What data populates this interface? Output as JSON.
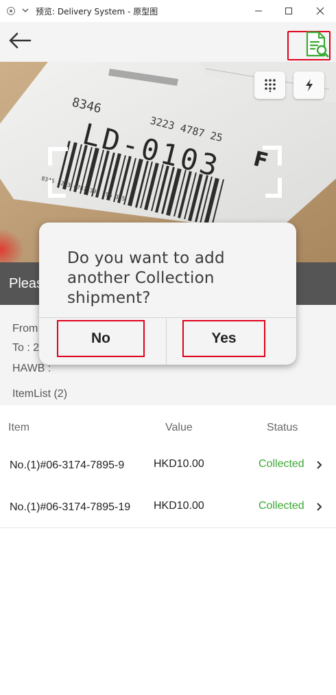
{
  "window": {
    "title": "预览: Delivery System - 原型图"
  },
  "camera": {
    "label_text": "LD-0103",
    "label_top_digits": "8346",
    "label_mid_digits": "3223 4787 25",
    "label_letter": "F",
    "barcode_digits": "8346 3223 4787 398 296 395"
  },
  "banner": {
    "text": "Pleas"
  },
  "shipment": {
    "from_label": "From",
    "to_label": "To : 2",
    "hawb_label": "HAWB :",
    "itemlist_label": "ItemList (2)"
  },
  "table": {
    "headers": {
      "item": "Item",
      "value": "Value",
      "status": "Status"
    },
    "rows": [
      {
        "item": "No.(1)#06-3174-7895-9",
        "value": "HKD10.00",
        "status": "Collected"
      },
      {
        "item": "No.(1)#06-3174-7895-19",
        "value": "HKD10.00",
        "status": "Collected"
      }
    ]
  },
  "dialog": {
    "message": "Do you want to add another Collection shipment?",
    "no_label": "No",
    "yes_label": "Yes"
  },
  "colors": {
    "status_green": "#3aa934",
    "highlight_red": "#e0001b",
    "banner_grey": "#555555",
    "doc_icon_green": "#3aa934"
  },
  "icons": {
    "back": "arrow-left-icon",
    "doc_search": "document-search-icon",
    "keypad": "keypad-icon",
    "flash": "flash-icon",
    "row_chevron": "chevron-right-icon"
  }
}
